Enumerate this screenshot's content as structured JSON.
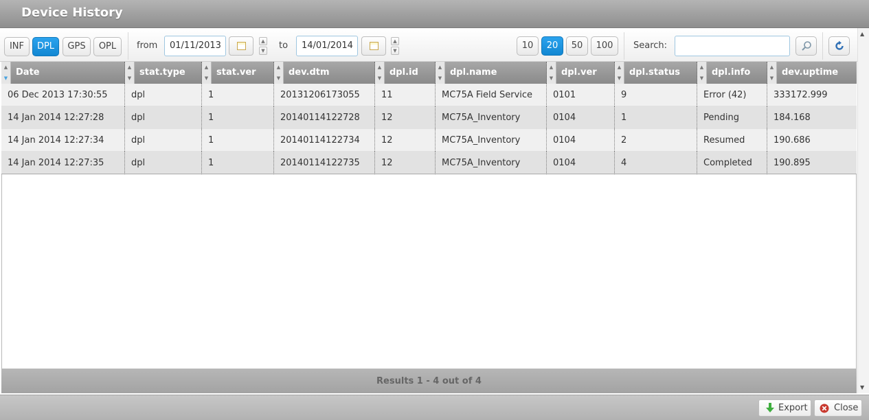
{
  "window": {
    "title": "Device History"
  },
  "toolbar": {
    "filters": [
      {
        "label": "INF",
        "active": false
      },
      {
        "label": "DPL",
        "active": true
      },
      {
        "label": "GPS",
        "active": false
      },
      {
        "label": "OPL",
        "active": false
      }
    ],
    "from_label": "from",
    "from_value": "01/11/2013",
    "to_label": "to",
    "to_value": "14/01/2014",
    "page_sizes": [
      {
        "label": "10",
        "active": false
      },
      {
        "label": "20",
        "active": true
      },
      {
        "label": "50",
        "active": false
      },
      {
        "label": "100",
        "active": false
      }
    ],
    "search_label": "Search:",
    "search_value": ""
  },
  "table": {
    "columns": [
      "Date",
      "stat.type",
      "stat.ver",
      "dev.dtm",
      "dpl.id",
      "dpl.name",
      "dpl.ver",
      "dpl.status",
      "dpl.info",
      "dev.uptime"
    ],
    "rows": [
      [
        "06 Dec 2013 17:30:55",
        "dpl",
        "1",
        "20131206173055",
        "11",
        "MC75A Field Service",
        "0101",
        "9",
        "Error (42)",
        "333172.999"
      ],
      [
        "14 Jan 2014 12:27:28",
        "dpl",
        "1",
        "20140114122728",
        "12",
        "MC75A_Inventory",
        "0104",
        "1",
        "Pending",
        "184.168"
      ],
      [
        "14 Jan 2014 12:27:34",
        "dpl",
        "1",
        "20140114122734",
        "12",
        "MC75A_Inventory",
        "0104",
        "2",
        "Resumed",
        "190.686"
      ],
      [
        "14 Jan 2014 12:27:35",
        "dpl",
        "1",
        "20140114122735",
        "12",
        "MC75A_Inventory",
        "0104",
        "4",
        "Completed",
        "190.895"
      ]
    ],
    "footer": "Results 1 - 4 out of 4"
  },
  "actions": {
    "export_label": "Export",
    "close_label": "Close"
  },
  "colors": {
    "accent": "#1a8fdc",
    "header": "#999999"
  }
}
